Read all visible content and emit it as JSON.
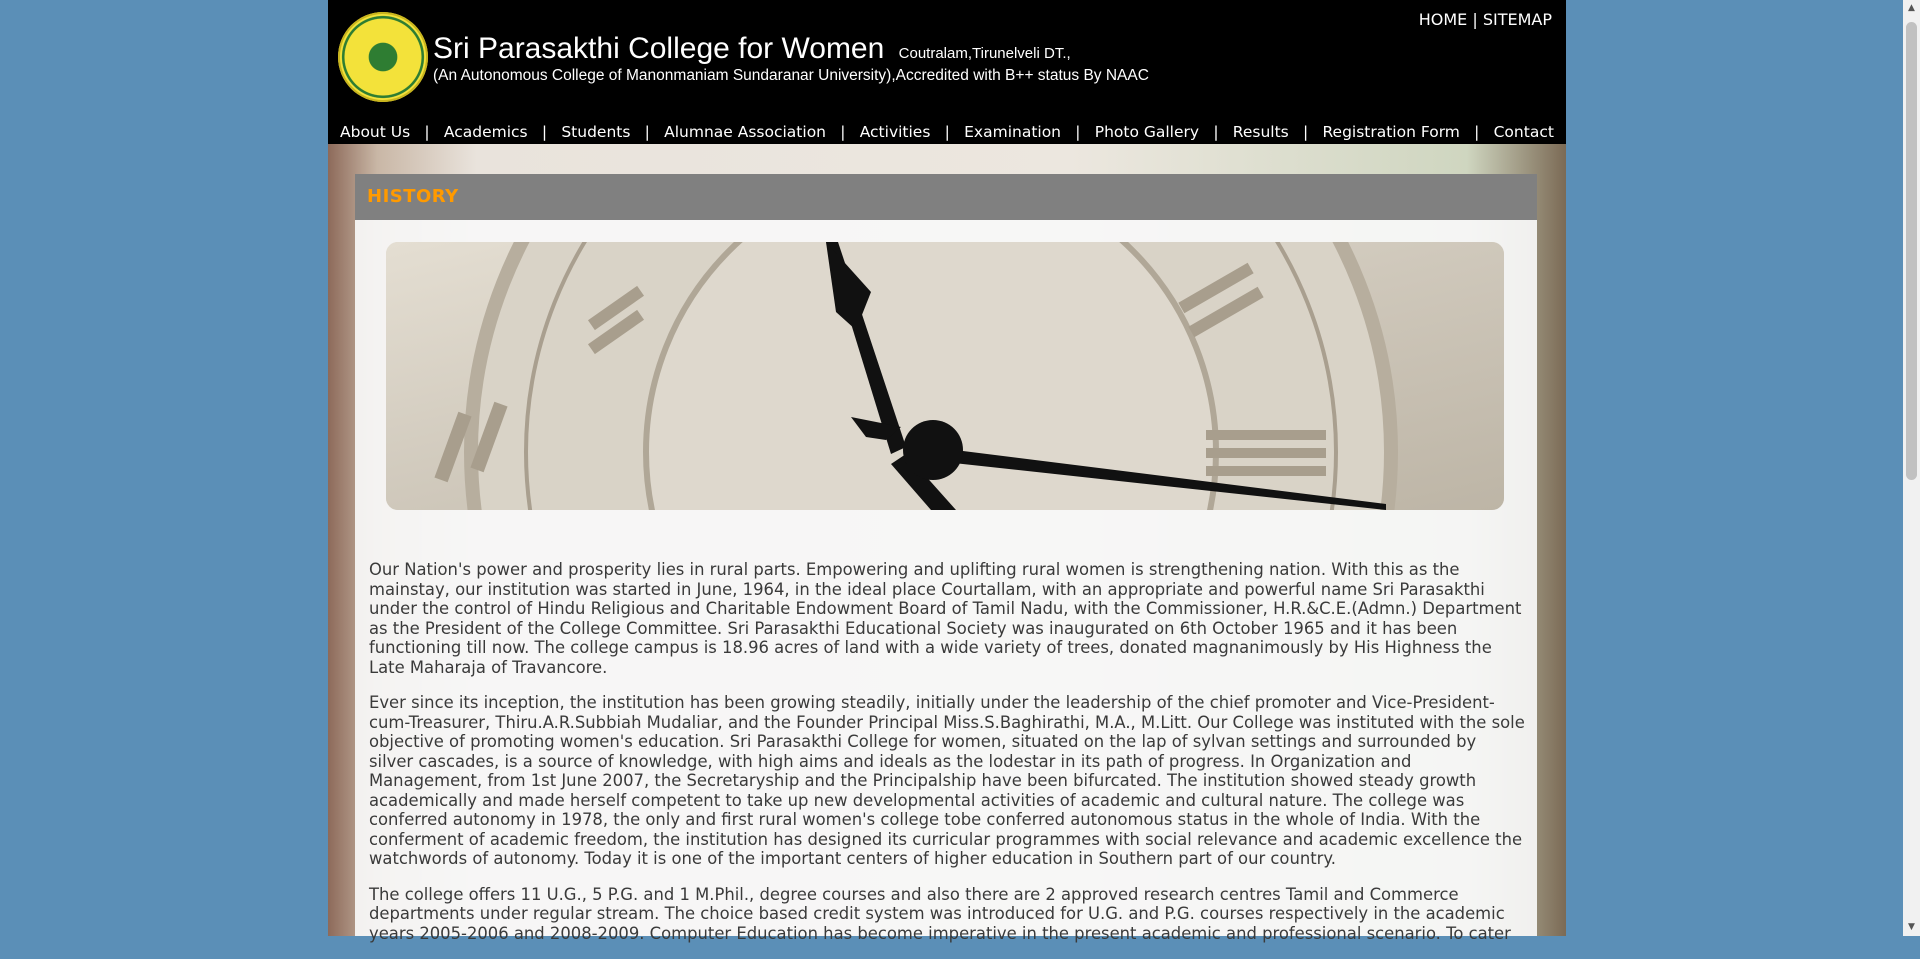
{
  "header": {
    "title": "Sri Parasakthi College for Women",
    "location": "Coutralam,Tirunelveli DT.,",
    "subtitle": "(An Autonomous College of Manonmaniam Sundaranar University),Accredited with B++ status By NAAC",
    "logo_icon": "college-emblem-icon",
    "top_links": {
      "home": "HOME",
      "separator": " | ",
      "sitemap": "SITEMAP"
    }
  },
  "nav": {
    "separator": "|",
    "items": [
      {
        "label": "About Us"
      },
      {
        "label": "Academics"
      },
      {
        "label": "Students"
      },
      {
        "label": "Alumnae Association"
      },
      {
        "label": "Activities"
      },
      {
        "label": "Examination"
      },
      {
        "label": "Photo Gallery"
      },
      {
        "label": "Results"
      },
      {
        "label": "Registration Form"
      },
      {
        "label": "Contact"
      }
    ]
  },
  "main": {
    "section_title": "HISTORY",
    "banner_icon": "clock-face-image",
    "paragraphs": [
      "Our Nation's power and prosperity lies in rural parts. Empowering and uplifting rural women is strengthening nation. With this as the mainstay, our institution was started in June, 1964, in the ideal place Courtallam, with an appropriate and powerful name Sri Parasakthi under the control of Hindu Religious and Charitable Endowment Board of Tamil Nadu, with the Commissioner, H.R.&C.E.(Admn.) Department as the President of the College Committee. Sri Parasakthi Educational Society was inaugurated on 6th October 1965 and it has been functioning till now. The college campus is 18.96 acres of land with a wide variety of trees, donated magnanimously by His Highness the Late Maharaja of Travancore.",
      "Ever since its inception, the institution has been growing steadily, initially under the leadership of the chief promoter and Vice-President-cum-Treasurer, Thiru.A.R.Subbiah Mudaliar, and the Founder Principal Miss.S.Baghirathi, M.A., M.Litt. Our College was instituted with the sole objective of promoting women's education. Sri Parasakthi College for women, situated on the lap of sylvan settings and surrounded by silver cascades, is a source of knowledge, with high aims and ideals as the lodestar in its path of progress. In Organization and Management, from 1st June 2007, the Secretaryship and the Principalship have been bifurcated. The institution showed steady growth academically and made herself competent to take up new developmental activities of academic and cultural nature. The college was conferred autonomy in 1978, the only and first rural women's college tobe conferred autonomous status in the whole of India. With the conferment of academic freedom, the institution has designed its curricular programmes with social relevance and academic excellence the watchwords of autonomy. Today it is one of the important centers of higher education in Southern part of our country.",
      "The college offers 11 U.G., 5 P.G. and 1 M.Phil., degree courses and also there are 2 approved research centres Tamil and Commerce departments under regular stream. The choice based credit system was introduced for U.G. and P.G. courses respectively in the academic years 2005-2006 and 2008-2009. Computer Education has become imperative in the present academic and professional scenario. To cater"
    ]
  },
  "colors": {
    "header_bg": "#000000",
    "page_bg": "#5b8fb7",
    "section_title": "#ff9a00",
    "section_bar": "#808080",
    "body_text": "#3a3a3a"
  },
  "scrollbar": {
    "up_icon": "scroll-up-arrow-icon",
    "down_icon": "scroll-down-arrow-icon"
  }
}
